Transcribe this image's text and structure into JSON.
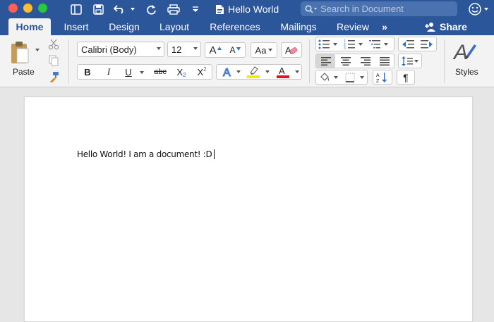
{
  "window": {
    "title": "Hello World",
    "search_placeholder": "Search in Document"
  },
  "tabs": [
    {
      "label": "Home",
      "active": true
    },
    {
      "label": "Insert"
    },
    {
      "label": "Design"
    },
    {
      "label": "Layout"
    },
    {
      "label": "References"
    },
    {
      "label": "Mailings"
    },
    {
      "label": "Review"
    }
  ],
  "share_label": "Share",
  "more_tabs_glyph": "»",
  "ribbon": {
    "paste_label": "Paste",
    "font_name": "Calibri (Body)",
    "font_size": "12",
    "styles_label": "Styles",
    "format": {
      "bold": "B",
      "italic": "I",
      "underline": "U",
      "strike": "abc",
      "subscript": "X",
      "subscript_mark": "2",
      "superscript": "X",
      "superscript_mark": "2",
      "grow": "A",
      "shrink": "A",
      "change_case": "Aa",
      "pilcrow": "¶",
      "sort": "AZ"
    }
  },
  "colors": {
    "brand": "#2b579a",
    "highlight": "#ffe600",
    "font_color": "#e81123"
  },
  "document": {
    "text": "Hello World! I am a document! :D"
  }
}
